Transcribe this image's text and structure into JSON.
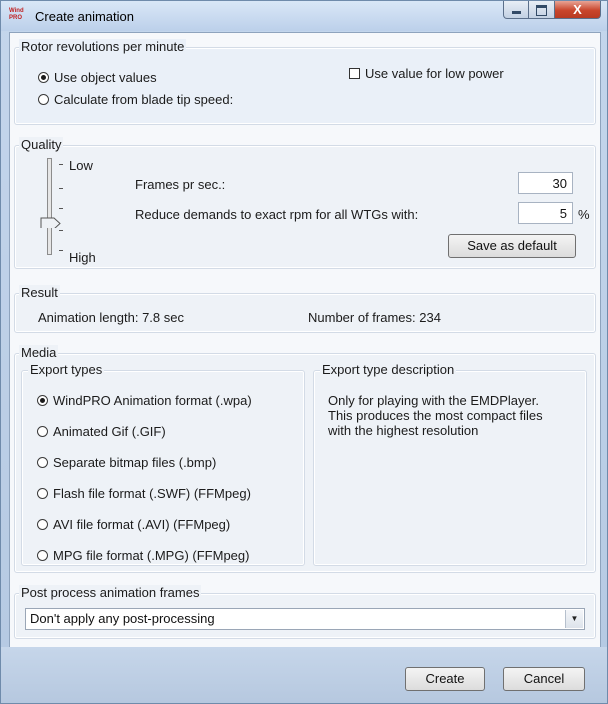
{
  "window": {
    "title": "Create animation",
    "icon_text": "Wind PRO",
    "close_glyph": "X"
  },
  "rotor": {
    "group_title": "Rotor revolutions per minute",
    "options": [
      "Use object values",
      "Calculate from blade tip speed:"
    ],
    "selected": 0,
    "low_power_label": "Use value for low power",
    "low_power_checked": false
  },
  "quality": {
    "group_title": "Quality",
    "low_label": "Low",
    "high_label": "High",
    "slider_level": 0.6,
    "frames_label": "Frames pr sec.:",
    "frames_value": "30",
    "reduce_label": "Reduce demands to exact rpm for all WTGs with:",
    "reduce_value": "5",
    "reduce_unit": "%",
    "save_default_label": "Save as default"
  },
  "result": {
    "group_title": "Result",
    "length_text": "Animation length: 7.8 sec",
    "frames_text": "Number of frames: 234"
  },
  "media": {
    "group_title": "Media",
    "export_types_title": "Export types",
    "export_types": [
      "WindPRO Animation format (.wpa)",
      "Animated Gif (.GIF)",
      "Separate bitmap files (.bmp)",
      "Flash file format (.SWF) (FFMpeg)",
      "AVI file format (.AVI) (FFMpeg)",
      "MPG file format (.MPG) (FFMpeg)"
    ],
    "selected_export": 0,
    "description_title": "Export type description",
    "description": "Only for playing with the EMDPlayer. This produces the most compact files with the highest resolution"
  },
  "post_process": {
    "group_title": "Post process animation frames",
    "selected_value": "Don't apply any post-processing"
  },
  "footer": {
    "create_label": "Create",
    "cancel_label": "Cancel"
  },
  "colors": {
    "title_bar": "#c4d6ec",
    "close_button": "#c9462c",
    "panel": "#eef2f7"
  }
}
